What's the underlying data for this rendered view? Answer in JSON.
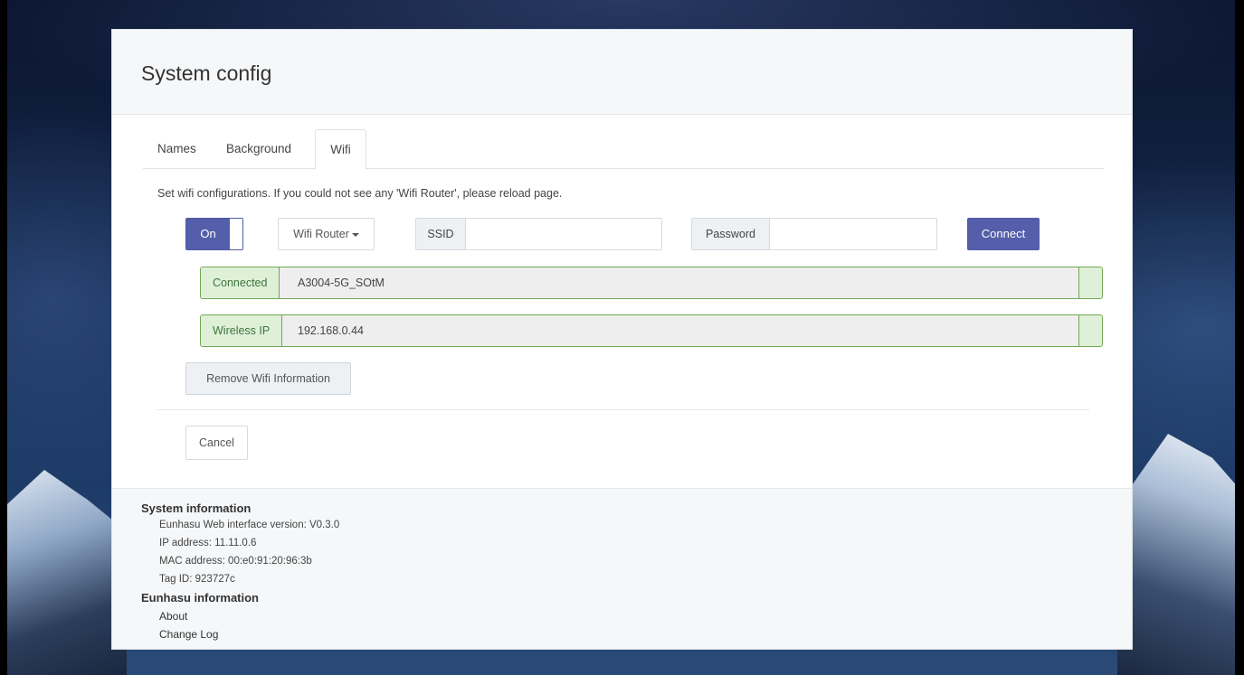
{
  "page": {
    "title": "System config"
  },
  "tabs": [
    {
      "label": "Names",
      "active": false
    },
    {
      "label": "Background",
      "active": false
    },
    {
      "label": "Wifi",
      "active": true
    }
  ],
  "wifi": {
    "description": "Set wifi configurations. If you could not see any 'Wifi Router', please reload page.",
    "toggle_label": "On",
    "toggle_state": "on",
    "router_dropdown_label": "Wifi Router",
    "ssid_label": "SSID",
    "ssid_value": "",
    "password_label": "Password",
    "password_value": "",
    "connect_label": "Connect",
    "status": {
      "connected_label": "Connected",
      "connected_value": "A3004-5G_SOtM",
      "ip_label": "Wireless IP",
      "ip_value": "192.168.0.44"
    },
    "remove_label": "Remove Wifi Information",
    "cancel_label": "Cancel"
  },
  "footer": {
    "system_heading": "System information",
    "system_items": [
      "Eunhasu Web interface version: V0.3.0",
      "IP address: 11.11.0.6",
      "MAC address: 00:e0:91:20:96:3b",
      "Tag ID: 923727c"
    ],
    "eunhasu_heading": "Eunhasu information",
    "links": [
      "About",
      "Change Log"
    ]
  },
  "colors": {
    "primary": "#545eaa",
    "success_bg": "#dff0d8",
    "success_border": "#6fa853",
    "success_text": "#3c763d"
  }
}
